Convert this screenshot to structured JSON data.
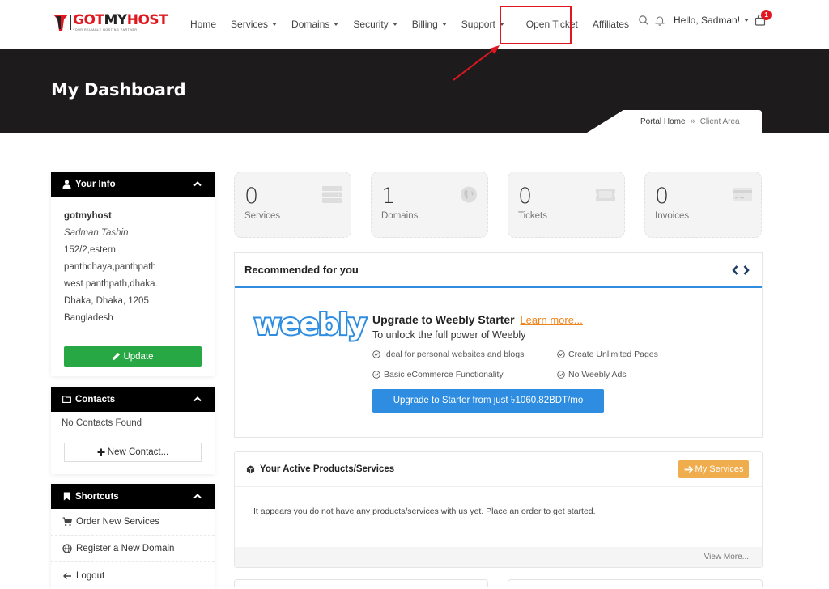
{
  "brand": {
    "name_red": "GOT",
    "name_black": "MY",
    "name_red2": "HOST",
    "tagline": "YOUR RELIABLE HOSTING PARTNER",
    "colors": {
      "primary": "#e0171f",
      "dark": "#1d1b1b"
    }
  },
  "nav": {
    "items": [
      {
        "label": "Home",
        "dropdown": false
      },
      {
        "label": "Services",
        "dropdown": true
      },
      {
        "label": "Domains",
        "dropdown": true
      },
      {
        "label": "Security",
        "dropdown": true
      },
      {
        "label": "Billing",
        "dropdown": true
      },
      {
        "label": "Support",
        "dropdown": true
      },
      {
        "label": "Open Ticket",
        "dropdown": false,
        "highlighted": true
      },
      {
        "label": "Affiliates",
        "dropdown": false
      }
    ],
    "search_icon": "search-icon",
    "notification_icon": "bell-icon",
    "user_greeting": "Hello, Sadman!",
    "cart_count": "1"
  },
  "hero": {
    "title": "My Dashboard",
    "breadcrumb": {
      "home": "Portal Home",
      "separator": "»",
      "current": "Client Area"
    }
  },
  "sidebar": {
    "your_info": {
      "title": "Your Info",
      "company": "gotmyhost",
      "name": "Sadman Tashin",
      "address_lines": [
        "152/2,estern",
        "panthchaya,panthpath",
        "west panthpath,dhaka.",
        "Dhaka, Dhaka, 1205",
        "Bangladesh"
      ],
      "update_label": "Update"
    },
    "contacts": {
      "title": "Contacts",
      "empty_text": "No Contacts Found",
      "new_contact_label": "New Contact..."
    },
    "shortcuts": {
      "title": "Shortcuts",
      "items": [
        {
          "label": "Order New Services",
          "icon": "cart-icon"
        },
        {
          "label": "Register a New Domain",
          "icon": "globe-icon"
        },
        {
          "label": "Logout",
          "icon": "arrow-left-icon"
        }
      ]
    }
  },
  "stats": [
    {
      "value": "0",
      "label": "Services",
      "icon": "server-icon"
    },
    {
      "value": "1",
      "label": "Domains",
      "icon": "globe-icon"
    },
    {
      "value": "0",
      "label": "Tickets",
      "icon": "ticket-icon"
    },
    {
      "value": "0",
      "label": "Invoices",
      "icon": "credit-card-icon"
    }
  ],
  "recommended": {
    "title": "Recommended for you",
    "logo_text": "weebly",
    "headline": "Upgrade to Weebly Starter",
    "learn_more": "Learn more...",
    "subtitle": "To unlock the full power of Weebly",
    "features": [
      "Ideal for personal websites and blogs",
      "Create Unlimited Pages",
      "Basic eCommerce Functionality",
      "No Weebly Ads"
    ],
    "cta": "Upgrade to Starter from just ৳1060.82BDT/mo",
    "accent": "#2e8de0"
  },
  "active_products": {
    "title": "Your Active Products/Services",
    "button": "My Services",
    "empty_text": "It appears you do not have any products/services with us yet. Place an order to get started.",
    "view_more": "View More...",
    "button_color": "#f0ad4e"
  }
}
